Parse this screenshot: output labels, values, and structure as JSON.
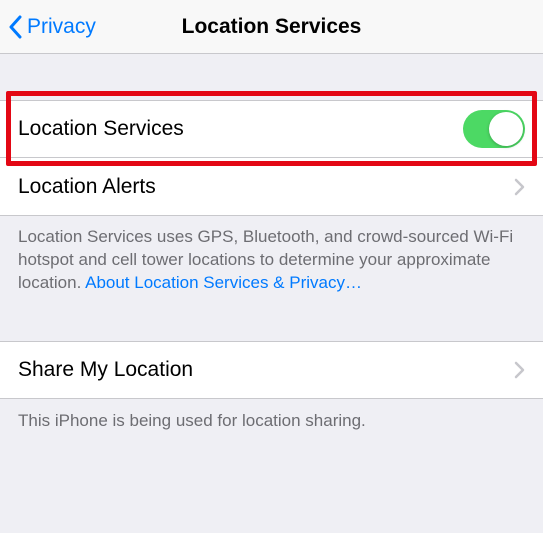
{
  "nav": {
    "back_label": "Privacy",
    "title": "Location Services"
  },
  "rows": {
    "location_services": "Location Services",
    "location_alerts": "Location Alerts",
    "share_my_location": "Share My Location"
  },
  "footer1": {
    "text": "Location Services uses GPS, Bluetooth, and crowd-sourced Wi-Fi hotspot and cell tower locations to determine your approximate location. ",
    "link": "About Location Services & Privacy…"
  },
  "footer2": "This iPhone is being used for location sharing.",
  "switch": {
    "on_color": "#4cd964"
  }
}
